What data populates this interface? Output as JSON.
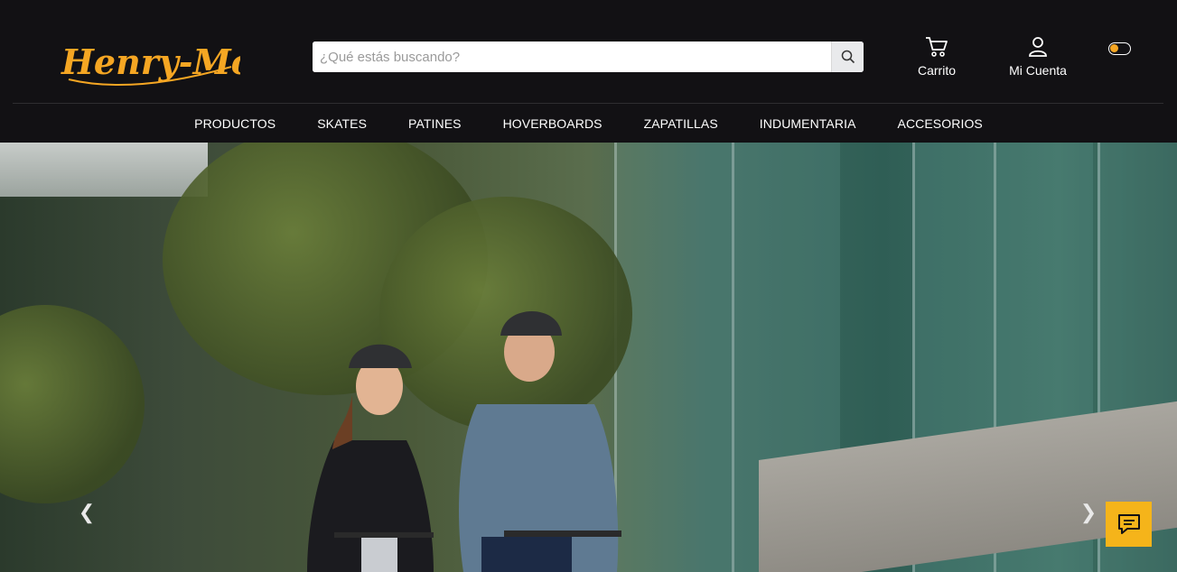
{
  "brand": {
    "logo_text": "Henry-Mov",
    "accent": "#f5a623"
  },
  "search": {
    "placeholder": "¿Qué estás buscando?",
    "value": ""
  },
  "actions": {
    "cart_label": "Carrito",
    "account_label": "Mi Cuenta"
  },
  "nav": [
    "PRODUCTOS",
    "SKATES",
    "PATINES",
    "HOVERBOARDS",
    "ZAPATILLAS",
    "INDUMENTARIA",
    "ACCESORIOS"
  ],
  "icons": {
    "search": "search-icon",
    "cart": "cart-icon",
    "account": "user-icon",
    "prev": "chevron-left-icon",
    "next": "chevron-right-icon",
    "chat": "chat-icon"
  },
  "theme_toggle": {
    "on": true
  },
  "colors": {
    "header_bg": "#121114",
    "chat_bg": "#f5b41a"
  }
}
